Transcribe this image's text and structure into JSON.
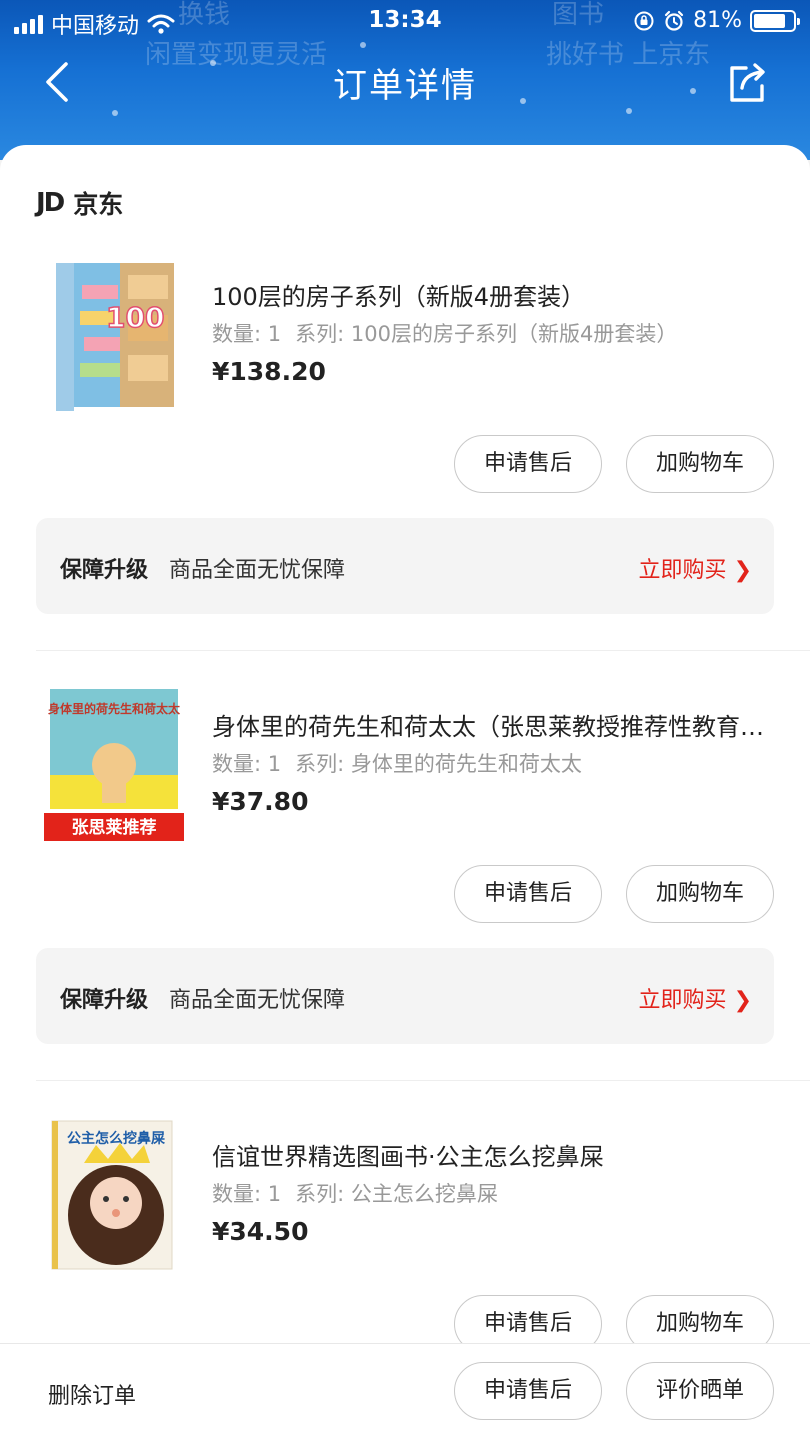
{
  "status_bar": {
    "carrier": "中国移动",
    "time": "13:34",
    "battery": "81%",
    "battery_level": 0.81
  },
  "header": {
    "title": "订单详情",
    "bg_text": [
      "换钱",
      "闲置变现更灵活",
      "图书",
      "挑好书 上京东"
    ]
  },
  "shop": {
    "logo": "JD",
    "name": "京东"
  },
  "products": [
    {
      "title": "100层的房子系列（新版4册套装）",
      "qty_label": "数量: 1",
      "series_label": "系列: 100层的房子系列（新版4册套装）",
      "price": "¥138.20",
      "cover_text": "100",
      "btn_after_sale": "申请售后",
      "btn_add_cart": "加购物车"
    },
    {
      "title": "身体里的荷先生和荷太太（张思莱教授推荐性教育…",
      "qty_label": "数量: 1",
      "series_label": "系列: 身体里的荷先生和荷太太",
      "price": "¥37.80",
      "cover_text": "身体里的荷先生和荷太太",
      "cover_banner": "张思莱推荐",
      "btn_after_sale": "申请售后",
      "btn_add_cart": "加购物车"
    },
    {
      "title": "信谊世界精选图画书·公主怎么挖鼻屎",
      "qty_label": "数量: 1",
      "series_label": "系列: 公主怎么挖鼻屎",
      "price": "¥34.50",
      "cover_text": "公主怎么挖鼻屎",
      "btn_after_sale": "申请售后",
      "btn_add_cart": "加购物车"
    }
  ],
  "guarantee": {
    "label": "保障升级",
    "desc": "商品全面无忧保障",
    "action": "立即购买",
    "chevron": "❯"
  },
  "bottom_bar": {
    "delete_label": "删除订单",
    "after_sale_label": "申请售后",
    "review_label": "评价晒单"
  },
  "colors": {
    "header_blue": "#1671d4",
    "accent_red": "#e2231a",
    "price_text": "#222222"
  }
}
